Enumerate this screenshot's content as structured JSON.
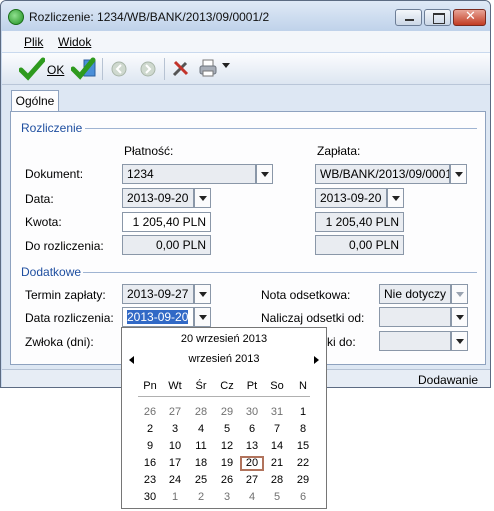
{
  "window": {
    "title": "Rozliczenie: 1234/WB/BANK/2013/09/0001/2",
    "icon": "app-icon",
    "controls": [
      "minimize-icon",
      "maximize-icon",
      "close-icon"
    ]
  },
  "menu": {
    "items": [
      {
        "label": "Plik"
      },
      {
        "label": "Widok"
      }
    ]
  },
  "toolbar": {
    "ok_label": "OK",
    "icons": [
      "checkmark-icon",
      "checkmark-edit-icon",
      "back-icon",
      "forward-icon",
      "tools-icon",
      "print-icon",
      "dropdown-arrow-icon"
    ]
  },
  "tabs": [
    {
      "label": "Ogólne"
    }
  ],
  "sections": {
    "rozliczenie": {
      "title": "Rozliczenie",
      "col_platnosc": "Płatność:",
      "col_zaplata": "Zapłata:",
      "dokument_label": "Dokument:",
      "dokument_platnosc": "1234",
      "dokument_zaplata": "WB/BANK/2013/09/0001/2",
      "data_label": "Data:",
      "data_platnosc": "2013-09-20",
      "data_zaplata": "2013-09-20",
      "kwota_label": "Kwota:",
      "kwota_platnosc": "1 205,40 PLN",
      "kwota_zaplata": "1 205,40 PLN",
      "do_rozliczenia_label": "Do rozliczenia:",
      "do_rozliczenia_platnosc": "0,00 PLN",
      "do_rozliczenia_zaplata": "0,00 PLN"
    },
    "dodatkowe": {
      "title": "Dodatkowe",
      "termin_label": "Termin zapłaty:",
      "termin_value": "2013-09-27",
      "data_rozl_label": "Data rozliczenia:",
      "data_rozl_value": "2013-09-20",
      "zwloka_label": "Zwłoka (dni):",
      "nota_label": "Nota odsetkowa:",
      "nota_value": "Nie dotyczy",
      "nalicz_od_label": "Naliczaj odsetki od:",
      "nalicz_do_label_visible": "etki do:"
    }
  },
  "status_bar": {
    "text": "Dodawanie"
  },
  "calendar": {
    "today_text": "20 wrzesień 2013",
    "month_text": "wrzesień 2013",
    "prev_icon": "prev-month-icon",
    "next_icon": "next-month-icon",
    "weekdays": [
      "Pn",
      "Wt",
      "Śr",
      "Cz",
      "Pt",
      "So",
      "N"
    ],
    "selected_day": "20",
    "weeks": [
      [
        {
          "d": "26",
          "o": true
        },
        {
          "d": "27",
          "o": true
        },
        {
          "d": "28",
          "o": true
        },
        {
          "d": "29",
          "o": true
        },
        {
          "d": "30",
          "o": true
        },
        {
          "d": "31",
          "o": true
        },
        {
          "d": "1",
          "o": false
        }
      ],
      [
        {
          "d": "2",
          "o": false
        },
        {
          "d": "3",
          "o": false
        },
        {
          "d": "4",
          "o": false
        },
        {
          "d": "5",
          "o": false
        },
        {
          "d": "6",
          "o": false
        },
        {
          "d": "7",
          "o": false
        },
        {
          "d": "8",
          "o": false
        }
      ],
      [
        {
          "d": "9",
          "o": false
        },
        {
          "d": "10",
          "o": false
        },
        {
          "d": "11",
          "o": false
        },
        {
          "d": "12",
          "o": false
        },
        {
          "d": "13",
          "o": false
        },
        {
          "d": "14",
          "o": false
        },
        {
          "d": "15",
          "o": false
        }
      ],
      [
        {
          "d": "16",
          "o": false
        },
        {
          "d": "17",
          "o": false
        },
        {
          "d": "18",
          "o": false
        },
        {
          "d": "19",
          "o": false
        },
        {
          "d": "20",
          "o": false
        },
        {
          "d": "21",
          "o": false
        },
        {
          "d": "22",
          "o": false
        }
      ],
      [
        {
          "d": "23",
          "o": false
        },
        {
          "d": "24",
          "o": false
        },
        {
          "d": "25",
          "o": false
        },
        {
          "d": "26",
          "o": false
        },
        {
          "d": "27",
          "o": false
        },
        {
          "d": "28",
          "o": false
        },
        {
          "d": "29",
          "o": false
        }
      ],
      [
        {
          "d": "30",
          "o": false
        },
        {
          "d": "1",
          "o": true
        },
        {
          "d": "2",
          "o": true
        },
        {
          "d": "3",
          "o": true
        },
        {
          "d": "4",
          "o": true
        },
        {
          "d": "5",
          "o": true
        },
        {
          "d": "6",
          "o": true
        }
      ]
    ]
  },
  "colors": {
    "accent": "#1f4fa0",
    "selection": "#3169c6",
    "today_border": "#b1735c"
  }
}
